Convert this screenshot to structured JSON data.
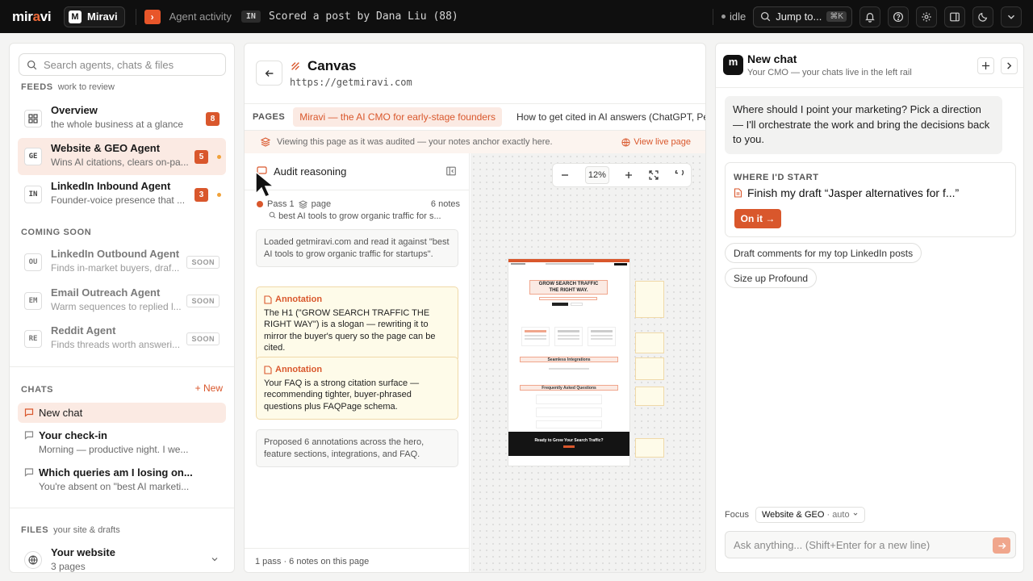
{
  "topbar": {
    "logo_prefix": "mir",
    "logo_dot": "a",
    "logo_suffix": "vi",
    "workspace_initial": "M",
    "workspace_name": "Miravi",
    "activity_label": "Agent activity",
    "activity_badge": "IN",
    "activity_text": "Scored a post by Dana Liu (88)",
    "status": "idle",
    "jump_label": "Jump to...",
    "jump_shortcut": "⌘K"
  },
  "sidebar": {
    "search_placeholder": "Search agents, chats & files",
    "feeds_label": "FEEDS",
    "feeds_sub": "work to review",
    "feeds": [
      {
        "icon": "grid-icon",
        "title": "Overview",
        "subtitle": "the whole business at a glance",
        "count": "8"
      },
      {
        "icon": "GE",
        "title": "Website & GEO Agent",
        "subtitle": "Wins AI citations, clears on-pa...",
        "count": "5"
      },
      {
        "icon": "IN",
        "title": "LinkedIn Inbound Agent",
        "subtitle": "Founder-voice presence that ...",
        "count": "3"
      }
    ],
    "coming_soon_label": "COMING SOON",
    "coming_soon": [
      {
        "icon": "OU",
        "title": "LinkedIn Outbound Agent",
        "subtitle": "Finds in-market buyers, draf...",
        "badge": "SOON"
      },
      {
        "icon": "EM",
        "title": "Email Outreach Agent",
        "subtitle": "Warm sequences to replied l...",
        "badge": "SOON"
      },
      {
        "icon": "RE",
        "title": "Reddit Agent",
        "subtitle": "Finds threads worth answeri...",
        "badge": "SOON"
      }
    ],
    "chats_label": "CHATS",
    "new_label": "+ New",
    "chats": [
      {
        "title": "New chat",
        "subtitle": ""
      },
      {
        "title": "Your check-in",
        "subtitle": "Morning — productive night. I we..."
      },
      {
        "title": "Which queries am I losing on...",
        "subtitle": "You're absent on \"best AI marketi..."
      }
    ],
    "files_label": "FILES",
    "files_sub": "your site & drafts",
    "website_title": "Your website",
    "website_sub": "3 pages"
  },
  "canvas": {
    "title": "Canvas",
    "url": "https://getmiravi.com",
    "pages_label": "PAGES",
    "pages": [
      "Miravi — the AI CMO for early-stage founders",
      "How to get cited in AI answers (ChatGPT, Pe"
    ],
    "viewing_text": "Viewing this page as it was audited — your notes anchor exactly here.",
    "view_live": "View live page",
    "audit_title": "Audit reasoning",
    "pass_label": "Pass 1",
    "pass_scope": "page",
    "pass_notes": "6 notes",
    "pass_query": "best AI tools to grow organic traffic for s...",
    "cards": [
      {
        "type": "log",
        "text": "Loaded getmiravi.com and read it against \"best AI tools to grow organic traffic for startups\"."
      },
      {
        "type": "annotation",
        "head": "Annotation",
        "text": "The H1 (\"GROW SEARCH TRAFFIC THE RIGHT WAY\") is a slogan — rewriting it to mirror the buyer's query so the page can be cited."
      },
      {
        "type": "annotation",
        "head": "Annotation",
        "text": "Your FAQ is a strong citation surface — recommending tighter, buyer-phrased questions plus FAQPage schema."
      },
      {
        "type": "log",
        "text": "Proposed 6 annotations across the hero, feature sections, integrations, and FAQ."
      }
    ],
    "footer": "1 pass · 6 notes on this page",
    "zoom": "12%",
    "preview": {
      "hero_line1": "GROW SEARCH TRAFFIC",
      "hero_line2": "THE RIGHT WAY.",
      "integrations": "Seamless Integrations",
      "faq": "Frequently Asked Questions",
      "cta": "Ready to Grow Your Search Traffic?"
    }
  },
  "chat": {
    "avatar": "m",
    "title": "New chat",
    "subtitle": "Your CMO — your chats live in the left rail",
    "message": "Where should I point your marketing? Pick a direction — I'll orchestrate the work and bring the decisions back to you.",
    "start_label": "WHERE I'D START",
    "start_task": "Finish my draft “Jasper alternatives for f...”",
    "on_it": "On it →",
    "chips": [
      "Draft comments for my top LinkedIn posts",
      "Size up Profound"
    ],
    "focus_label": "Focus",
    "focus_value": "Website & GEO",
    "focus_mode": "· auto",
    "input_placeholder": "Ask anything...  (Shift+Enter for a new line)"
  },
  "colors": {
    "accent": "#d9572c",
    "accent_soft": "#fbeae3",
    "topbar": "#0f0f0f",
    "annotation_bg": "#fefbe9"
  }
}
